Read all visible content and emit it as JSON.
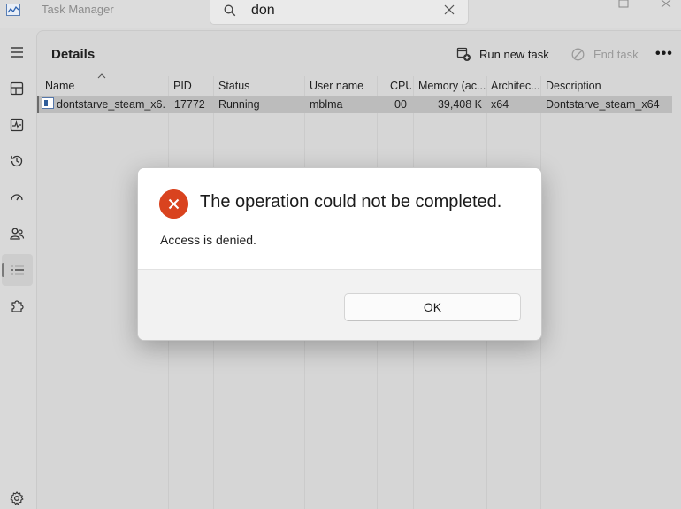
{
  "window": {
    "title": "Task Manager",
    "search_value": "don",
    "search_icon": "search-icon",
    "clear_icon": "close-icon"
  },
  "nav": [
    {
      "id": "hamburger",
      "icon": "hamburger-menu-icon"
    },
    {
      "id": "processes",
      "icon": "processes-icon"
    },
    {
      "id": "performance",
      "icon": "performance-icon"
    },
    {
      "id": "app-history",
      "icon": "history-icon"
    },
    {
      "id": "startup",
      "icon": "startup-speedometer-icon"
    },
    {
      "id": "users",
      "icon": "users-icon"
    },
    {
      "id": "details",
      "icon": "details-list-icon",
      "active": true
    },
    {
      "id": "services",
      "icon": "services-puzzle-icon"
    },
    {
      "id": "settings",
      "icon": "gear-icon"
    }
  ],
  "page": {
    "title": "Details",
    "run_new_task": "Run new task",
    "end_task": "End task",
    "more": "•••"
  },
  "table": {
    "columns": [
      "Name",
      "PID",
      "Status",
      "User name",
      "CPU",
      "Memory (ac...",
      "Architec...",
      "Description"
    ],
    "rows": [
      {
        "name": "dontstarve_steam_x6...",
        "pid": "17772",
        "status": "Running",
        "user": "mblma",
        "cpu": "00",
        "memory": "39,408 K",
        "arch": "x64",
        "description": "Dontstarve_steam_x64"
      }
    ]
  },
  "dialog": {
    "icon": "error-icon",
    "title": "The operation could not be completed.",
    "message": "Access is denied.",
    "ok_label": "OK"
  },
  "colors": {
    "error": "#d9431f",
    "selection": "#bcbcbc",
    "background": "#d9d9d9"
  }
}
